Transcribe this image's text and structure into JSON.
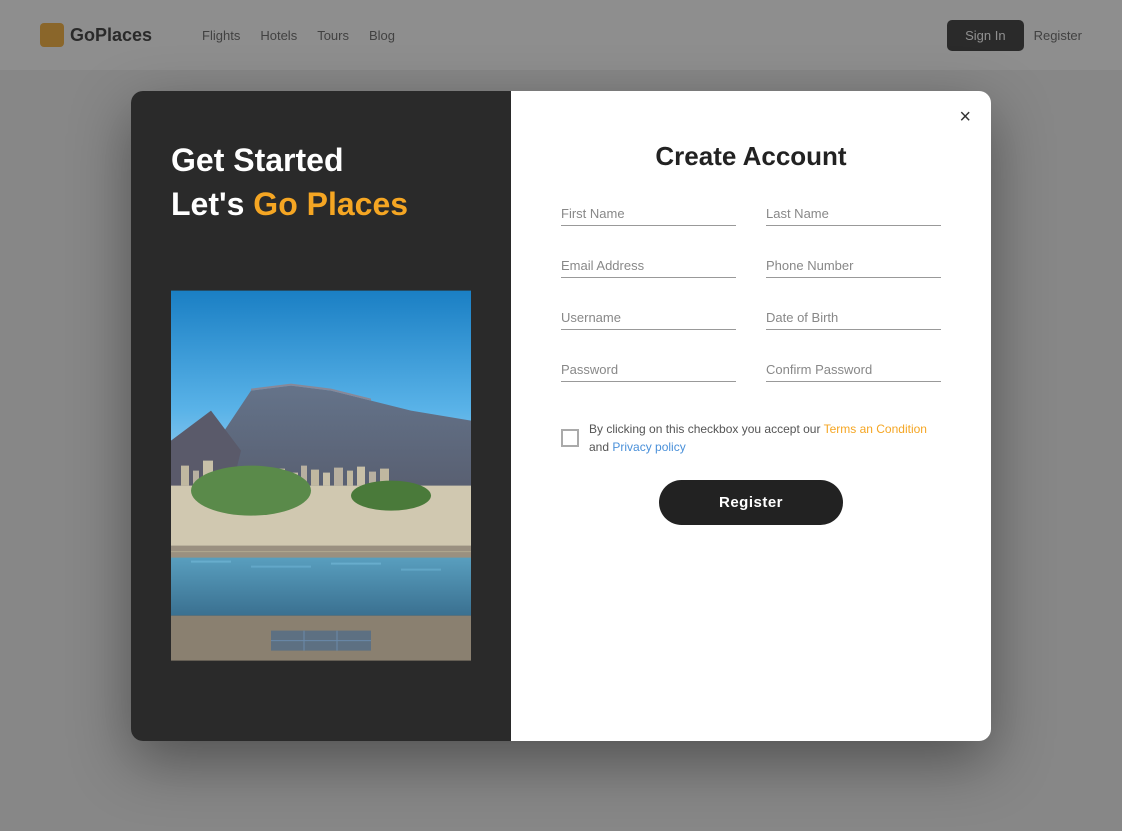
{
  "navbar": {
    "logo_text": "GoPlaces",
    "links": [
      "Flights",
      "Hotels",
      "Tours",
      "Blog"
    ],
    "right_btn_label": "Sign In",
    "right_link_label": "Register"
  },
  "modal": {
    "left": {
      "title_line1": "Get Started",
      "title_line2_plain": "Let's ",
      "title_line2_highlight": "Go Places",
      "image_alt": "Cape Town cityscape with Table Mountain"
    },
    "right": {
      "title": "Create Account",
      "close_label": "×",
      "fields": [
        {
          "id": "first-name",
          "placeholder": "First Name"
        },
        {
          "id": "last-name",
          "placeholder": "Last Name"
        },
        {
          "id": "email",
          "placeholder": "Email Address"
        },
        {
          "id": "phone",
          "placeholder": "Phone Number"
        },
        {
          "id": "username",
          "placeholder": "Username"
        },
        {
          "id": "dob",
          "placeholder": "Date of Birth"
        },
        {
          "id": "password",
          "placeholder": "Password"
        },
        {
          "id": "confirm-password",
          "placeholder": "Confirm Password"
        }
      ],
      "terms_prefix": "By clicking on this checkbox you accept our ",
      "terms_link_text": "Terms an Condition",
      "terms_middle": " and ",
      "privacy_link_text": "Privacy policy",
      "register_btn_label": "Register"
    }
  }
}
